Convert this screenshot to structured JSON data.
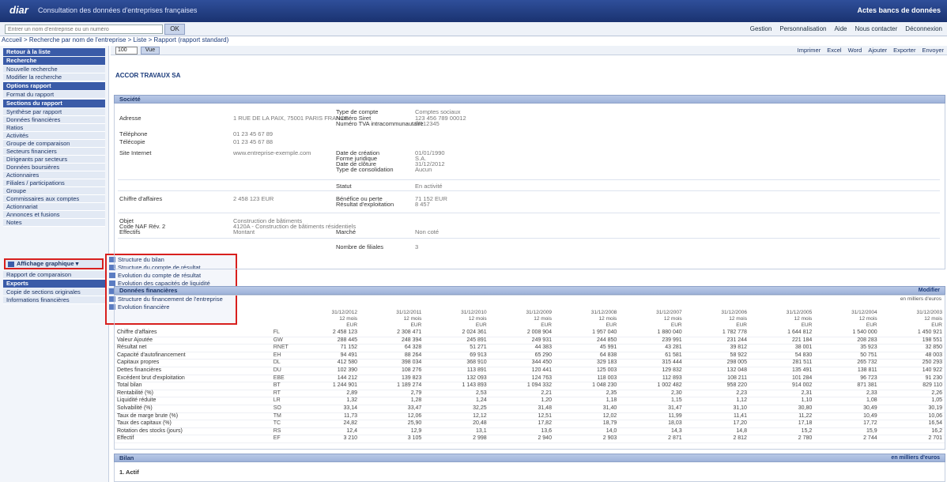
{
  "app": {
    "logo": "diar",
    "title": "Consultation des données d'entreprises françaises",
    "user": "Actes bancs de données"
  },
  "top": {
    "search_placeholder": "Entrer un nom d'entreprise ou un numéro",
    "search_btn": "OK",
    "links": [
      "Gestion",
      "Personnalisation",
      "Aide",
      "Nous contacter",
      "Déconnexion"
    ]
  },
  "breadcrumb": "Accueil > Recherche par nom de l'entreprise > Liste > Rapport (rapport standard)",
  "sidebar": {
    "items": [
      {
        "t": "head",
        "label": "Retour à la liste"
      },
      {
        "t": "head",
        "label": "Recherche"
      },
      {
        "t": "item",
        "label": "Nouvelle recherche"
      },
      {
        "t": "item",
        "label": "Modifier la recherche"
      },
      {
        "t": "head",
        "label": "Options rapport"
      },
      {
        "t": "item",
        "label": "Format du rapport"
      },
      {
        "t": "head",
        "label": "Sections du rapport"
      },
      {
        "t": "item",
        "label": "Synthèse par rapport"
      },
      {
        "t": "item",
        "label": "Données financières"
      },
      {
        "t": "item",
        "label": "Ratios"
      },
      {
        "t": "item",
        "label": "Activités"
      },
      {
        "t": "item",
        "label": "Groupe de comparaison"
      },
      {
        "t": "item",
        "label": "Secteurs financiers"
      },
      {
        "t": "item",
        "label": "Dirigeants par secteurs"
      },
      {
        "t": "item",
        "label": "Données boursières"
      },
      {
        "t": "item",
        "label": "Actionnaires"
      },
      {
        "t": "item",
        "label": "Filiales / participations"
      },
      {
        "t": "item",
        "label": "Groupe"
      },
      {
        "t": "item",
        "label": "Commissaires aux comptes"
      },
      {
        "t": "item",
        "label": "Actionnariat"
      },
      {
        "t": "item",
        "label": "Annonces et fusions"
      },
      {
        "t": "item",
        "label": "Notes"
      }
    ],
    "menu_button": "Affichage graphique",
    "bottom": [
      {
        "t": "item",
        "label": "Rapport de comparaison"
      },
      {
        "t": "head",
        "label": "Exports"
      },
      {
        "t": "item",
        "label": "Copie de sections originales"
      },
      {
        "t": "item",
        "label": "Informations financières"
      }
    ]
  },
  "popup": {
    "items": [
      "Structure du bilan",
      "Structure du compte de résultat",
      "Evolution du compte de résultat",
      "Evolution des capacités de liquidité",
      "Structure de l'endettement",
      "Structure du financement de l'entreprise",
      "Evolution financière"
    ],
    "selected": 4
  },
  "viewbar": {
    "select": "100",
    "btn": "Vue",
    "actions": [
      "Imprimer",
      "Excel",
      "Word",
      "Ajouter",
      "Exporter",
      "Envoyer"
    ]
  },
  "company": "ACCOR TRAVAUX SA",
  "identity": {
    "header": "Société",
    "left": [
      {
        "label": "Adresse",
        "value": "1 RUE DE LA PAIX, 75001 PARIS FRANCE"
      },
      {
        "label": "Téléphone",
        "value": "01 23 45 67 89"
      },
      {
        "label": "Télécopie",
        "value": "01 23 45 67 88"
      },
      {
        "label": "Site Internet",
        "value": "www.entreprise-exemple.com"
      },
      {
        "label": "Chiffre d'affaires",
        "value": "2 458 123 EUR"
      },
      {
        "label": "Objet",
        "value": "Construction de bâtiments"
      },
      {
        "label": "Code NAF Rév. 2",
        "value": "4120A - Construction de bâtiments résidentiels"
      },
      {
        "label": "Effectifs",
        "value": "Montant"
      }
    ],
    "right": [
      {
        "label": "Type de compte",
        "value": "Comptes sociaux"
      },
      {
        "label": "Numéro Siret",
        "value": "123 456 789 00012"
      },
      {
        "label": "Numéro TVA intracommunautaire",
        "value": "FR12345"
      },
      {
        "label": "Date de création",
        "value": "01/01/1990"
      },
      {
        "label": "Forme juridique",
        "value": "S.A."
      },
      {
        "label": "Date de clôture",
        "value": "31/12/2012"
      },
      {
        "label": "Type de consolidation",
        "value": "Aucun"
      },
      {
        "label": "Statut",
        "value": "En activité"
      },
      {
        "label": "Bénéfice ou perte",
        "value": "71 152 EUR"
      },
      {
        "label": "Résultat d'exploitation",
        "value": "8 457"
      },
      {
        "label": "Marché",
        "value": "Non coté"
      },
      {
        "label": "Nombre de filiales",
        "value": "3"
      }
    ]
  },
  "fin": {
    "header": "Données financières",
    "sub": "en milliers d'euros",
    "unit_link": "Modifier",
    "columns": [
      "31/12/2012\n12 mois\nEUR",
      "31/12/2011\n12 mois\nEUR",
      "31/12/2010\n12 mois\nEUR",
      "31/12/2009\n12 mois\nEUR",
      "31/12/2008\n12 mois\nEUR",
      "31/12/2007\n12 mois\nEUR",
      "31/12/2006\n12 mois\nEUR",
      "31/12/2005\n12 mois\nEUR",
      "31/12/2004\n12 mois\nEUR",
      "31/12/2003\n12 mois\nEUR"
    ],
    "rows": [
      {
        "l": "Chiffre d'affaires",
        "a": "FL",
        "v": [
          "2 458 123",
          "2 308 471",
          "2 024 361",
          "2 008 904",
          "1 957 040",
          "1 880 040",
          "1 782 778",
          "1 644 812",
          "1 540 000",
          "1 450 921"
        ]
      },
      {
        "l": "Valeur Ajoutée",
        "a": "GW",
        "v": [
          "288 445",
          "248 394",
          "245 891",
          "249 931",
          "244 850",
          "239 991",
          "231 244",
          "221 184",
          "208 283",
          "198 551"
        ]
      },
      {
        "l": "Résultat net",
        "a": "RNET",
        "v": [
          "71 152",
          "64 328",
          "51 271",
          "44 383",
          "45 991",
          "43 281",
          "39 812",
          "38 001",
          "35 923",
          "32 850"
        ]
      },
      {
        "l": "Capacité d'autofinancement",
        "a": "EH",
        "v": [
          "94 491",
          "88 264",
          "69 913",
          "65 290",
          "64 838",
          "61 581",
          "58 922",
          "54 830",
          "50 751",
          "48 003"
        ]
      },
      {
        "l": "Capitaux propres",
        "a": "DL",
        "v": [
          "412 580",
          "398 034",
          "368 910",
          "344 450",
          "329 183",
          "315 444",
          "298 005",
          "281 511",
          "265 732",
          "250 293"
        ]
      },
      {
        "l": "Dettes financières",
        "a": "DU",
        "v": [
          "102 390",
          "108 276",
          "113 891",
          "120 441",
          "125 003",
          "129 832",
          "132 048",
          "135 491",
          "138 811",
          "140 922"
        ]
      },
      {
        "l": "Excédent brut d'exploitation",
        "a": "EBE",
        "v": [
          "144 212",
          "139 823",
          "132 093",
          "124 763",
          "118 003",
          "112 893",
          "108 211",
          "101 284",
          "96 723",
          "91 230"
        ]
      },
      {
        "l": "Total bilan",
        "a": "BT",
        "v": [
          "1 244 901",
          "1 189 274",
          "1 143 893",
          "1 094 332",
          "1 048 230",
          "1 002 482",
          "958 220",
          "914 002",
          "871 381",
          "829 110"
        ]
      },
      {
        "l": "Rentabilité (%)",
        "a": "RT",
        "v": [
          "2,89",
          "2,79",
          "2,53",
          "2,21",
          "2,35",
          "2,30",
          "2,23",
          "2,31",
          "2,33",
          "2,26"
        ]
      },
      {
        "l": "Liquidité réduite",
        "a": "LR",
        "v": [
          "1,32",
          "1,28",
          "1,24",
          "1,20",
          "1,18",
          "1,15",
          "1,12",
          "1,10",
          "1,08",
          "1,05"
        ]
      },
      {
        "l": "Solvabilité (%)",
        "a": "SO",
        "v": [
          "33,14",
          "33,47",
          "32,25",
          "31,48",
          "31,40",
          "31,47",
          "31,10",
          "30,80",
          "30,49",
          "30,19"
        ]
      },
      {
        "l": "Taux de marge brute (%)",
        "a": "TM",
        "v": [
          "11,73",
          "12,06",
          "12,12",
          "12,51",
          "12,02",
          "11,99",
          "11,41",
          "11,22",
          "10,49",
          "10,06"
        ]
      },
      {
        "l": "Taux des capitaux (%)",
        "a": "TC",
        "v": [
          "24,82",
          "25,90",
          "20,48",
          "17,82",
          "18,79",
          "18,03",
          "17,20",
          "17,18",
          "17,72",
          "16,54"
        ]
      },
      {
        "l": "Rotation des stocks (jours)",
        "a": "RS",
        "v": [
          "12,4",
          "12,9",
          "13,1",
          "13,6",
          "14,0",
          "14,3",
          "14,8",
          "15,2",
          "15,9",
          "16,2"
        ]
      },
      {
        "l": "Effectif",
        "a": "EF",
        "v": [
          "3 210",
          "3 105",
          "2 998",
          "2 940",
          "2 903",
          "2 871",
          "2 812",
          "2 780",
          "2 744",
          "2 701"
        ]
      }
    ]
  },
  "p3": {
    "header": "Bilan",
    "sub": "en milliers d'euros",
    "item": "1. Actif"
  }
}
